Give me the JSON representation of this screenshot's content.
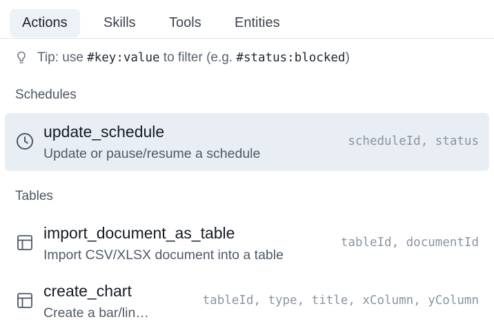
{
  "tabs": [
    {
      "label": "Actions",
      "active": true
    },
    {
      "label": "Skills",
      "active": false
    },
    {
      "label": "Tools",
      "active": false
    },
    {
      "label": "Entities",
      "active": false
    }
  ],
  "tip": {
    "icon": "lightbulb-icon",
    "prefix": "Tip: use ",
    "code1": "#key:value",
    "middle": " to filter (e.g. ",
    "code2": "#status:blocked",
    "suffix": ")"
  },
  "sections": [
    {
      "title": "Schedules",
      "items": [
        {
          "icon": "clock-icon",
          "name": "update_schedule",
          "description": "Update or pause/resume a schedule",
          "params": "scheduleId, status",
          "selected": true
        }
      ]
    },
    {
      "title": "Tables",
      "items": [
        {
          "icon": "table-icon",
          "name": "import_document_as_table",
          "description": "Import CSV/XLSX document into a table",
          "params": "tableId, documentId",
          "selected": false
        },
        {
          "icon": "table-icon",
          "name": "create_chart",
          "description": "Create a bar/line chart",
          "params": "tableId, type, title, xColumn, yColumn",
          "selected": false
        }
      ]
    }
  ],
  "colors": {
    "selected_bg": "#e9eef5",
    "active_tab_bg": "#eef1f5",
    "param_text": "#8b94a0"
  }
}
